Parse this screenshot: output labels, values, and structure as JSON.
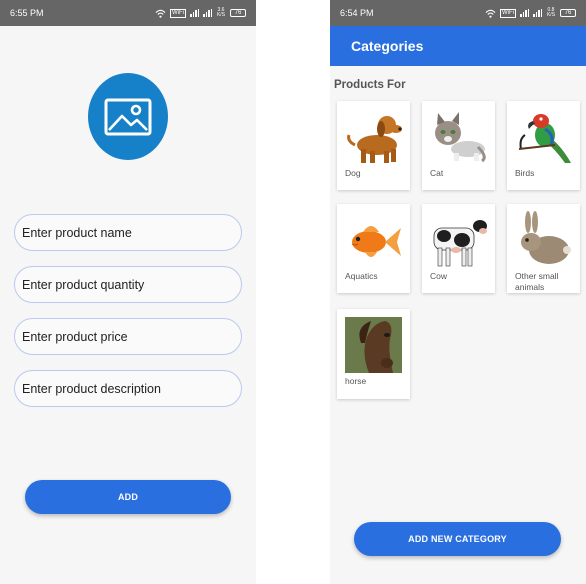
{
  "left_screen": {
    "status_bar": {
      "time": "6:55 PM",
      "wifi_tag": "WiFi",
      "network_speed": "3.6 K/S",
      "battery": "76"
    },
    "form": {
      "name_placeholder": "Enter product name",
      "quantity_placeholder": "Enter product quantity",
      "price_placeholder": "Enter product price",
      "description_placeholder": "Enter product description"
    },
    "add_button_label": "ADD",
    "avatar_icon": "image-icon"
  },
  "right_screen": {
    "status_bar": {
      "time": "6:54 PM",
      "wifi_tag": "WiFi",
      "network_speed": "0.8 K/S",
      "battery": "76"
    },
    "app_bar_title": "Categories",
    "section_title": "Products For",
    "categories": [
      {
        "label": "Dog",
        "icon": "dog-image"
      },
      {
        "label": "Cat",
        "icon": "cat-image"
      },
      {
        "label": "Birds",
        "icon": "bird-image"
      },
      {
        "label": "Aquatics",
        "icon": "fish-image"
      },
      {
        "label": "Cow",
        "icon": "cow-image"
      },
      {
        "label": "Other small animals",
        "icon": "rabbit-image"
      },
      {
        "label": "horse",
        "icon": "horse-image"
      }
    ],
    "add_category_button_label": "ADD NEW CATEGORY"
  },
  "colors": {
    "primary": "#2a6fe0",
    "avatar_blue": "#1681c8",
    "status_bar": "#666666",
    "field_border": "#b9c9ef"
  }
}
